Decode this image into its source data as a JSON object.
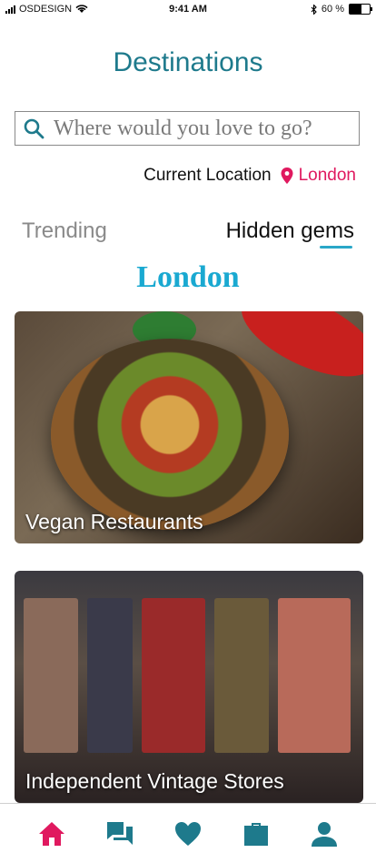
{
  "status_bar": {
    "carrier": "OSDESIGN",
    "time": "9:41 AM",
    "battery": "60 %",
    "battery_level": 0.6
  },
  "header": {
    "title": "Destinations"
  },
  "search": {
    "placeholder": "Where would you love to go?",
    "value": ""
  },
  "location": {
    "label": "Current Location",
    "city": "London"
  },
  "tabs": [
    {
      "label": "Trending",
      "active": false
    },
    {
      "label": "Hidden gems",
      "active": true
    }
  ],
  "city_heading": "London",
  "cards": [
    {
      "caption": "Vegan Restaurants"
    },
    {
      "caption": "Independent Vintage Stores"
    }
  ],
  "colors": {
    "teal": "#1e7a8c",
    "accent_pink": "#e0195f",
    "heading_blue": "#1aa9d1",
    "tab_underline": "#2aa7c8"
  },
  "nav": [
    {
      "icon": "home-icon",
      "active": true
    },
    {
      "icon": "chat-icon",
      "active": false
    },
    {
      "icon": "heart-icon",
      "active": false
    },
    {
      "icon": "briefcase-icon",
      "active": false
    },
    {
      "icon": "profile-icon",
      "active": false
    }
  ]
}
